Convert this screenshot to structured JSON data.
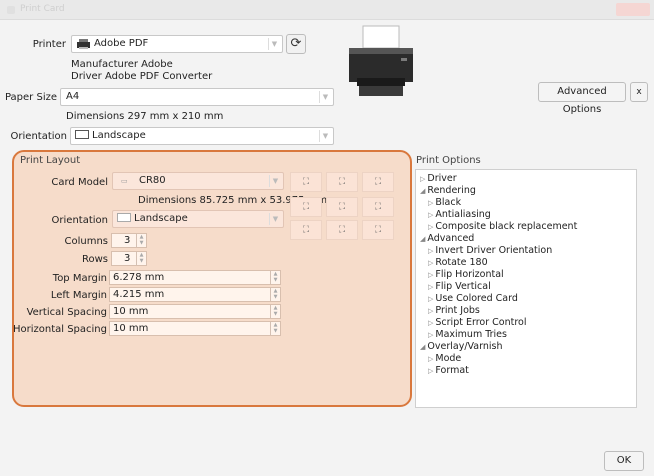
{
  "titlebar": {
    "title": "Print Card"
  },
  "printer": {
    "label": "Printer",
    "value": "Adobe PDF",
    "manufacturer": "Manufacturer Adobe",
    "driver": "Driver Adobe PDF Converter"
  },
  "paper": {
    "label": "Paper Size",
    "value": "A4",
    "dimensions": "Dimensions 297 mm x 210 mm"
  },
  "orientation": {
    "label": "Orientation",
    "value": "Landscape"
  },
  "buttons": {
    "advanced": "Advanced Options",
    "close_x": "x",
    "ok": "OK"
  },
  "layout": {
    "title": "Print Layout",
    "card_model_label": "Card Model",
    "card_model_value": "CR80",
    "card_dimensions": "Dimensions 85.725 mm x 53.975 mm",
    "orientation_label": "Orientation",
    "orientation_value": "Landscape",
    "columns_label": "Columns",
    "columns_value": "3",
    "rows_label": "Rows",
    "rows_value": "3",
    "top_margin_label": "Top Margin",
    "top_margin_value": "6.278 mm",
    "left_margin_label": "Left Margin",
    "left_margin_value": "4.215 mm",
    "vertical_spacing_label": "Vertical Spacing",
    "vertical_spacing_value": "10 mm",
    "horizontal_spacing_label": "Horizontal Spacing",
    "horizontal_spacing_value": "10 mm"
  },
  "options": {
    "title": "Print Options",
    "items": [
      {
        "label": "Driver",
        "expanded": false
      },
      {
        "label": "Rendering",
        "expanded": true
      },
      {
        "label": "Black",
        "expanded": false
      },
      {
        "label": "Antialiasing",
        "expanded": false
      },
      {
        "label": "Composite black replacement",
        "expanded": false
      },
      {
        "label": "Advanced",
        "expanded": true
      },
      {
        "label": "Invert Driver Orientation",
        "expanded": false
      },
      {
        "label": "Rotate 180",
        "expanded": false
      },
      {
        "label": "Flip Horizontal",
        "expanded": false
      },
      {
        "label": "Flip Vertical",
        "expanded": false
      },
      {
        "label": "Use Colored Card",
        "expanded": false
      },
      {
        "label": "Print Jobs",
        "expanded": false
      },
      {
        "label": "Script Error Control",
        "expanded": false
      },
      {
        "label": "Maximum Tries",
        "expanded": false
      },
      {
        "label": "Overlay/Varnish",
        "expanded": true
      },
      {
        "label": "Mode",
        "expanded": false
      },
      {
        "label": "Format",
        "expanded": false
      }
    ]
  },
  "icons": {
    "refresh": "refresh-icon",
    "printer": "printer-icon",
    "card": "card-icon",
    "expand": "expand-triangle-icon",
    "collapse": "collapse-triangle-icon"
  },
  "colors": {
    "highlight_border": "#d9783d",
    "highlight_fill": "#f8c8a8"
  }
}
